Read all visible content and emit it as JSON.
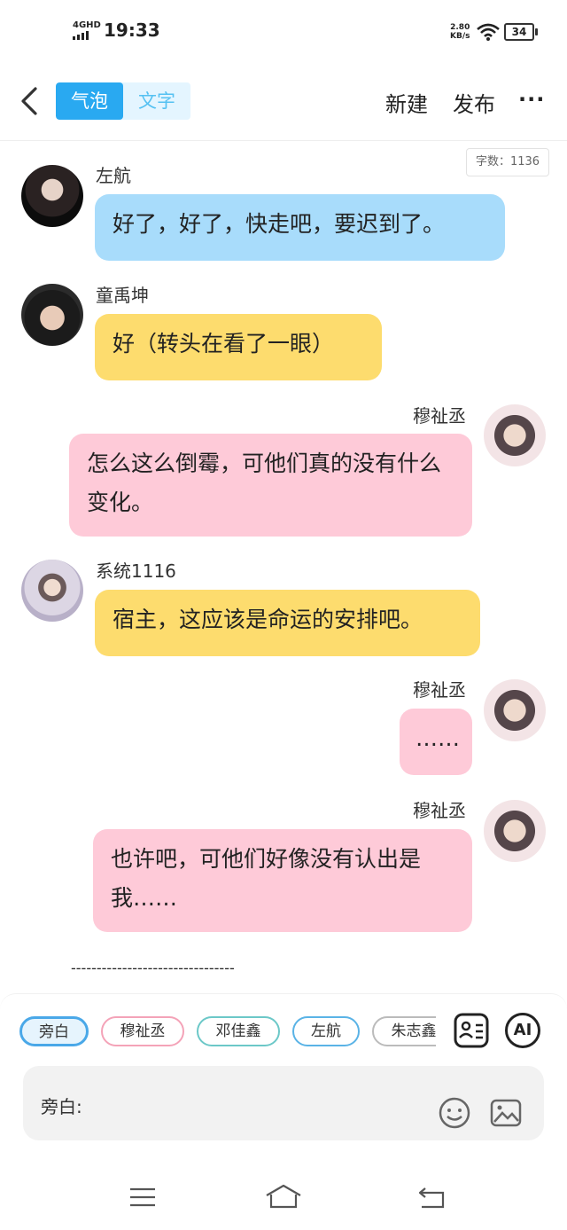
{
  "status_bar": {
    "network": "4GHD",
    "time": "19:33",
    "net_speed_value": "2.80",
    "net_speed_unit": "KB/s",
    "battery": "34"
  },
  "top_bar": {
    "tabs": [
      "气泡",
      "文字"
    ],
    "active_tab": "气泡",
    "new_label": "新建",
    "publish_label": "发布",
    "more_label": "···"
  },
  "word_count": "字数：1136",
  "messages": [
    {
      "name": "左航",
      "text": "好了，好了，快走吧，要迟到了。",
      "side": "left",
      "color": "#a8dcfb"
    },
    {
      "name": "童禹坤",
      "text": "好（转头在看了一眼）",
      "side": "left",
      "color": "#fddc6e"
    },
    {
      "name": "穆祉丞",
      "text": "怎么这么倒霉，可他们真的没有什么变化。",
      "side": "right",
      "color": "#fecad8"
    },
    {
      "name": "系统1116",
      "text": "宿主，这应该是命运的安排吧。",
      "side": "left",
      "color": "#fddc6e"
    },
    {
      "name": "穆祉丞",
      "text": "……",
      "side": "right",
      "color": "#fecad8"
    },
    {
      "name": "穆祉丞",
      "text": "也许吧，可他们好像没有认出是我……",
      "side": "right",
      "color": "#fecad8"
    }
  ],
  "separator": "--------------------------------",
  "roles": [
    {
      "label": "旁白",
      "color": "#4aa8e8",
      "fill": "#e6f4fd",
      "selected": true
    },
    {
      "label": "穆祉丞",
      "color": "#f4a3b8",
      "fill": "#ffffff",
      "selected": false
    },
    {
      "label": "邓佳鑫",
      "color": "#6cc8c8",
      "fill": "#ffffff",
      "selected": false
    },
    {
      "label": "左航",
      "color": "#5ab3e6",
      "fill": "#ffffff",
      "selected": false
    },
    {
      "label": "朱志鑫",
      "color": "#bbbbbb",
      "fill": "#ffffff",
      "selected": false
    }
  ],
  "tools": {
    "contacts_icon": "contact-card-icon",
    "ai_label": "AI"
  },
  "input": {
    "label": "旁白:",
    "emoji_icon": "smiley-icon",
    "image_icon": "image-icon"
  },
  "nav": [
    "menu-icon",
    "home-icon",
    "back-icon"
  ]
}
